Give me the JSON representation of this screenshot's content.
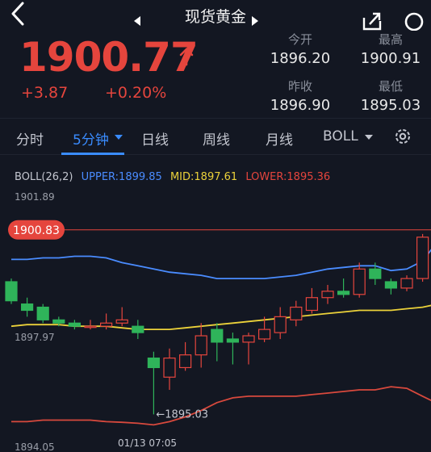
{
  "header": {
    "title": "现货黄金"
  },
  "quote": {
    "price": "1900.77",
    "change": "+3.87",
    "change_pct": "+0.20%",
    "open_label": "今开",
    "open": "1896.20",
    "high_label": "最高",
    "high": "1900.91",
    "prev_close_label": "昨收",
    "prev_close": "1896.90",
    "low_label": "最低",
    "low": "1895.03"
  },
  "tabs": [
    {
      "label": "分时"
    },
    {
      "label": "5分钟"
    },
    {
      "label": "日线"
    },
    {
      "label": "周线"
    },
    {
      "label": "月线"
    },
    {
      "label": "BOLL"
    }
  ],
  "colors": {
    "up": "#e5453d",
    "down": "#2fb45a",
    "upper": "#4a8cff",
    "mid": "#ecd23a",
    "lower": "#d8493d",
    "accent": "#3a8cff"
  },
  "chart_data": {
    "type": "candlestick",
    "indicator": {
      "name": "BOLL(26,2)",
      "upper_label": "UPPER:1899.85",
      "mid_label": "MID:1897.61",
      "lower_label": "LOWER:1895.36"
    },
    "y_labels": [
      "1901.89",
      "1897.97",
      "1894.05"
    ],
    "ylim": [
      1894.05,
      1901.89
    ],
    "current_price_label": "1900.83",
    "current_price": 1900.83,
    "low_marker_label": "←1895.03",
    "low_marker_value": 1895.03,
    "x_label": "01/13 07:05",
    "candles": [
      {
        "o": 1899.2,
        "c": 1898.6,
        "h": 1899.3,
        "l": 1898.5
      },
      {
        "o": 1898.5,
        "c": 1898.3,
        "h": 1898.7,
        "l": 1898.1
      },
      {
        "o": 1898.4,
        "c": 1898.0,
        "h": 1898.5,
        "l": 1897.9
      },
      {
        "o": 1898.0,
        "c": 1897.9,
        "h": 1898.1,
        "l": 1897.8
      },
      {
        "o": 1897.9,
        "c": 1897.8,
        "h": 1898.0,
        "l": 1897.7
      },
      {
        "o": 1897.8,
        "c": 1897.8,
        "h": 1898.0,
        "l": 1897.7
      },
      {
        "o": 1897.8,
        "c": 1897.9,
        "h": 1898.2,
        "l": 1897.7
      },
      {
        "o": 1897.9,
        "c": 1898.0,
        "h": 1898.4,
        "l": 1897.8
      },
      {
        "o": 1897.8,
        "c": 1897.6,
        "h": 1898.0,
        "l": 1897.4
      },
      {
        "o": 1896.8,
        "c": 1896.5,
        "h": 1897.0,
        "l": 1895.03
      },
      {
        "o": 1896.2,
        "c": 1896.8,
        "h": 1897.1,
        "l": 1895.8
      },
      {
        "o": 1896.5,
        "c": 1896.9,
        "h": 1897.3,
        "l": 1896.4
      },
      {
        "o": 1896.9,
        "c": 1897.5,
        "h": 1897.9,
        "l": 1896.5
      },
      {
        "o": 1897.7,
        "c": 1897.3,
        "h": 1897.9,
        "l": 1896.7
      },
      {
        "o": 1897.4,
        "c": 1897.3,
        "h": 1897.6,
        "l": 1896.6
      },
      {
        "o": 1897.3,
        "c": 1897.5,
        "h": 1897.6,
        "l": 1896.6
      },
      {
        "o": 1897.4,
        "c": 1897.7,
        "h": 1898.1,
        "l": 1897.3
      },
      {
        "o": 1897.6,
        "c": 1898.1,
        "h": 1898.4,
        "l": 1897.4
      },
      {
        "o": 1898.0,
        "c": 1898.4,
        "h": 1898.6,
        "l": 1897.8
      },
      {
        "o": 1898.3,
        "c": 1898.7,
        "h": 1899.0,
        "l": 1898.2
      },
      {
        "o": 1898.7,
        "c": 1898.9,
        "h": 1899.1,
        "l": 1898.5
      },
      {
        "o": 1898.9,
        "c": 1898.8,
        "h": 1899.3,
        "l": 1898.7
      },
      {
        "o": 1898.8,
        "c": 1899.6,
        "h": 1899.8,
        "l": 1898.7
      },
      {
        "o": 1899.6,
        "c": 1899.3,
        "h": 1899.8,
        "l": 1899.1
      },
      {
        "o": 1899.2,
        "c": 1899.0,
        "h": 1899.3,
        "l": 1898.8
      },
      {
        "o": 1899.0,
        "c": 1899.3,
        "h": 1899.4,
        "l": 1898.9
      },
      {
        "o": 1899.3,
        "c": 1900.6,
        "h": 1900.7,
        "l": 1899.2
      },
      {
        "o": 1900.6,
        "c": 1900.8,
        "h": 1900.9,
        "l": 1900.4
      }
    ],
    "series": [
      {
        "name": "UPPER",
        "values": [
          1899.9,
          1899.9,
          1899.95,
          1899.95,
          1900.0,
          1900.0,
          1899.95,
          1899.8,
          1899.7,
          1899.6,
          1899.5,
          1899.45,
          1899.4,
          1899.3,
          1899.3,
          1899.3,
          1899.3,
          1899.35,
          1899.4,
          1899.5,
          1899.6,
          1899.65,
          1899.7,
          1899.7,
          1899.55,
          1899.6,
          1899.85,
          1900.5
        ]
      },
      {
        "name": "MID",
        "values": [
          1897.8,
          1897.85,
          1897.85,
          1897.85,
          1897.8,
          1897.8,
          1897.8,
          1897.75,
          1897.7,
          1897.7,
          1897.7,
          1897.75,
          1897.8,
          1897.85,
          1897.9,
          1897.95,
          1898.0,
          1898.05,
          1898.1,
          1898.15,
          1898.2,
          1898.25,
          1898.3,
          1898.3,
          1898.3,
          1898.35,
          1898.4,
          1898.5
        ]
      },
      {
        "name": "LOWER",
        "values": [
          1894.8,
          1894.8,
          1894.85,
          1894.85,
          1894.85,
          1894.85,
          1894.8,
          1894.78,
          1894.75,
          1894.7,
          1894.8,
          1894.95,
          1895.15,
          1895.4,
          1895.55,
          1895.6,
          1895.6,
          1895.6,
          1895.6,
          1895.65,
          1895.7,
          1895.75,
          1895.8,
          1895.8,
          1895.9,
          1895.85,
          1895.6,
          1895.36
        ]
      }
    ]
  }
}
